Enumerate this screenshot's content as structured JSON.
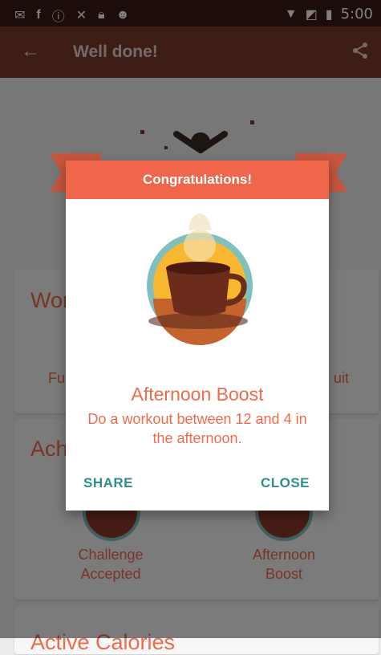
{
  "status_bar": {
    "time": "5:00",
    "icons_left": [
      "message-icon",
      "facebook-icon",
      "info-icon",
      "no-signal-icon",
      "lock-icon",
      "android-icon"
    ],
    "icons_right": [
      "wifi-icon",
      "no-sim-icon",
      "battery-charging-icon"
    ]
  },
  "app_bar": {
    "title": "Well done!"
  },
  "background": {
    "card1": {
      "heading_visible": "Wor",
      "left_fragment": "Fu",
      "right_fragment": "uit"
    },
    "card2": {
      "heading_visible": "Ach",
      "badges": [
        {
          "label": "Challenge\nAccepted"
        },
        {
          "label": "Afternoon\nBoost"
        }
      ]
    },
    "card3": {
      "heading_visible": "Active Calories"
    }
  },
  "dialog": {
    "header": "Congratulations!",
    "badge_name": "Afternoon Boost",
    "description": "Do a workout between 12 and 4 in the afternoon.",
    "share_label": "SHARE",
    "close_label": "CLOSE"
  },
  "colors": {
    "primary_dark": "#3a1a14",
    "primary": "#7a3a2c",
    "accent": "#f0664a",
    "teal": "#2f8f8c"
  }
}
